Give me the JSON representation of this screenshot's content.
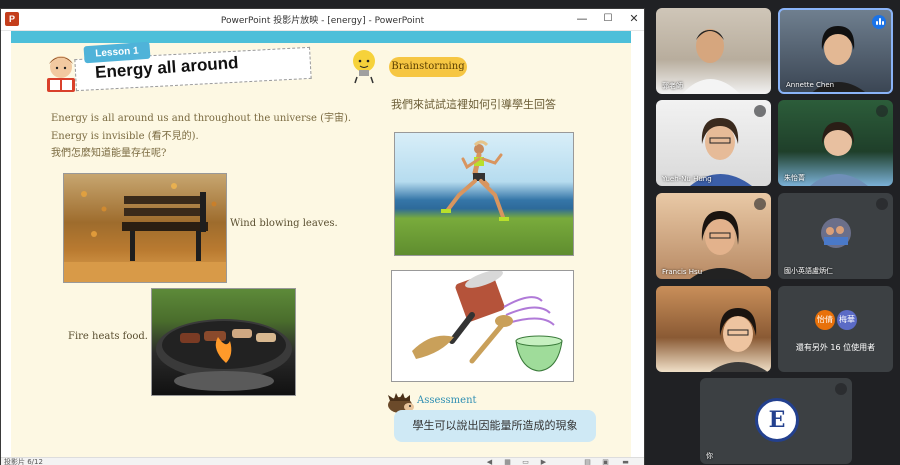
{
  "window": {
    "app_logo": "P",
    "title": "PowerPoint 投影片放映 - [energy] - PowerPoint",
    "minimize_glyph": "—",
    "maximize_glyph": "☐",
    "close_glyph": "✕"
  },
  "slide": {
    "lesson_tag": "Lesson 1",
    "lesson_title": "Energy all around",
    "brainstorming": "Brainstorming",
    "intro_lines": [
      "Energy is all around us and throughout the universe (宇宙).",
      "Energy is invisible (看不見的).",
      "我們怎麼知道能量存在呢?"
    ],
    "brainstorm_question": "我們來試試這裡如何引導學生回答",
    "caption_wind": "Wind blowing leaves.",
    "caption_fire": "Fire heats food.",
    "assessment_label": "Assessment",
    "assessment_text": "學生可以說出因能量所造成的現象"
  },
  "status": {
    "slide_counter": "投影片 6/12"
  },
  "meet": {
    "tiles": [
      {
        "name": "郭老師"
      },
      {
        "name": "Annette Chen"
      },
      {
        "name": "Yueh-Nu Hung"
      },
      {
        "name": "朱怡菁"
      },
      {
        "name": "Francis Hsu"
      },
      {
        "name": "國小英語盧炳仁"
      },
      {
        "name": ""
      },
      {
        "name": "你"
      }
    ],
    "others": {
      "avatar_1": "怡倩",
      "avatar_2": "梅華",
      "text": "還有另外 16 位使用者",
      "avatar_1_color": "#e8710a",
      "avatar_2_color": "#5b6bc6"
    },
    "self_logo_letter": "E"
  },
  "colors": {
    "accent": "#8ab4f8",
    "meet_background": "#202124",
    "slide_background": "#fdf8e3"
  }
}
